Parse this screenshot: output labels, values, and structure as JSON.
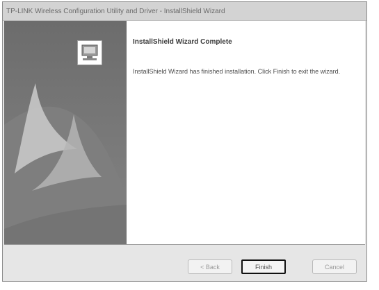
{
  "window": {
    "title": "TP-LINK Wireless Configuration Utility and Driver - InstallShield Wizard"
  },
  "main": {
    "heading": "InstallShield Wizard Complete",
    "message": "InstallShield Wizard has finished installation. Click Finish to exit the wizard."
  },
  "buttons": {
    "back": "< Back",
    "finish": "Finish",
    "cancel": "Cancel"
  },
  "icons": {
    "setup": "setup-computer-icon"
  }
}
